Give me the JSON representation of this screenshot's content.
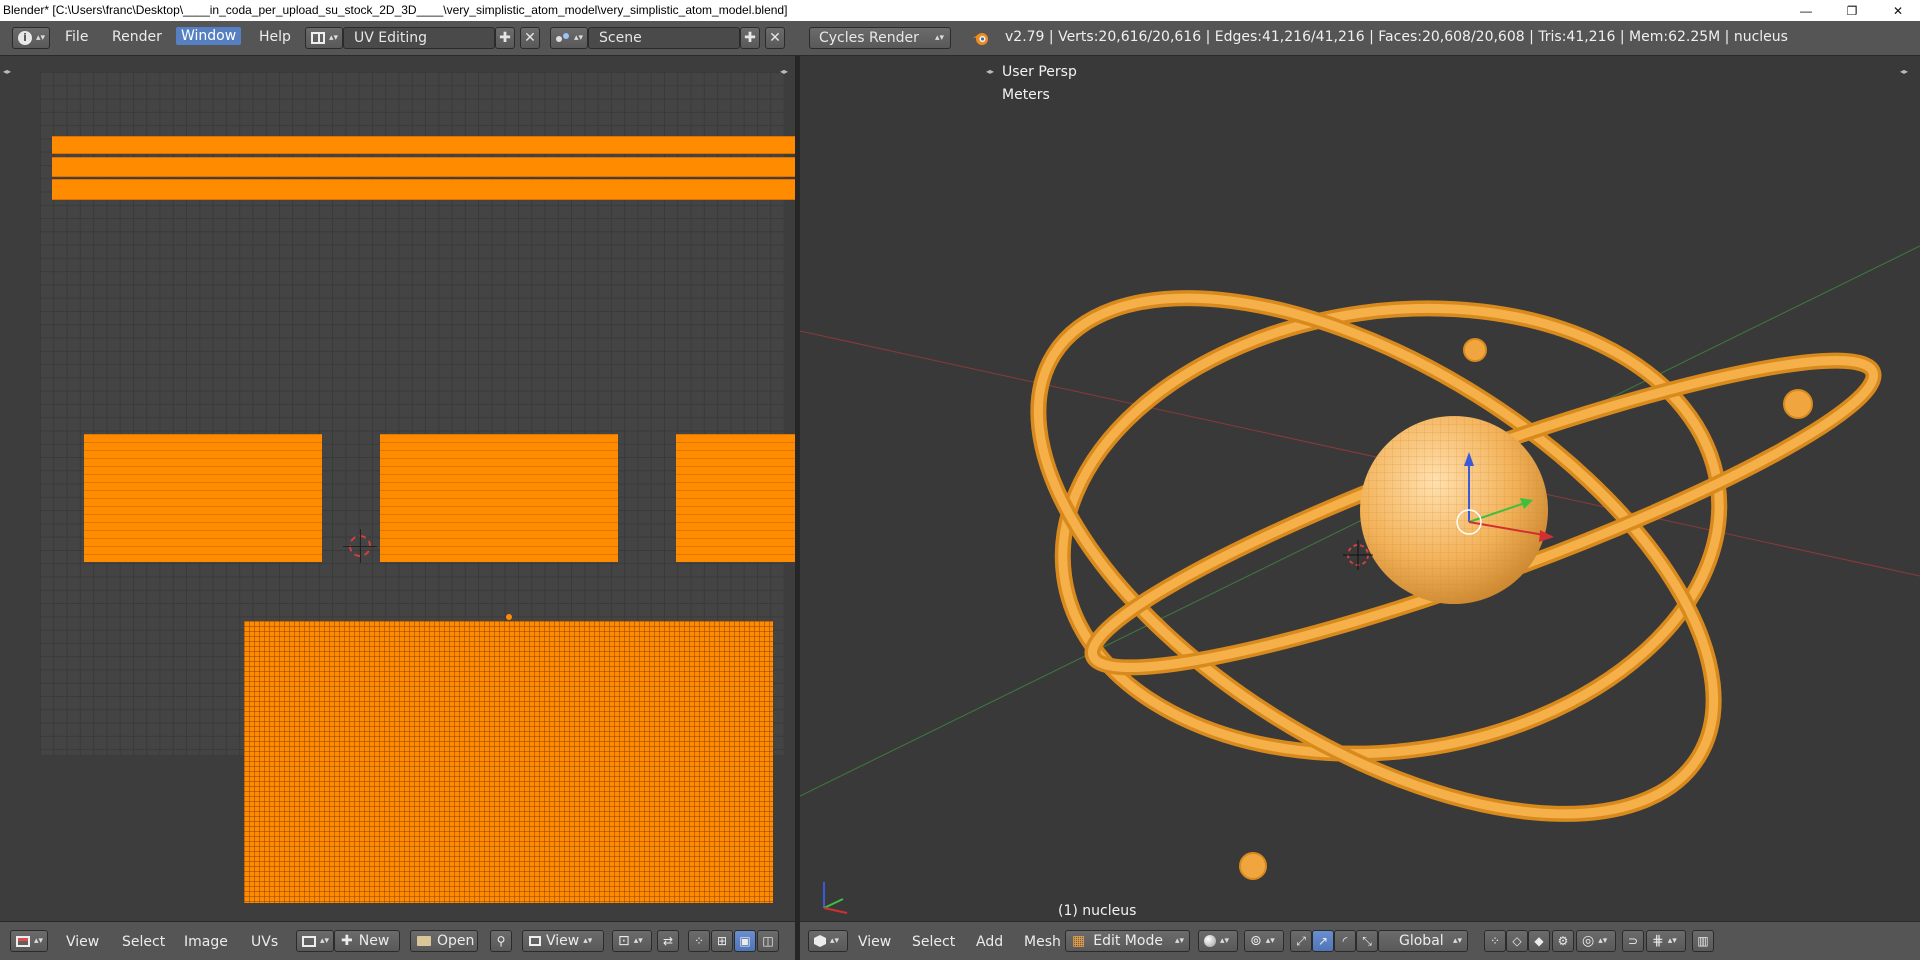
{
  "window": {
    "title": "Blender* [C:\\Users\\franc\\Desktop\\____in_coda_per_upload_su_stock_2D_3D____\\very_simplistic_atom_model\\very_simplistic_atom_model.blend]",
    "minimize_glyph": "—",
    "maximize_glyph": "❐",
    "close_glyph": "✕"
  },
  "info_header": {
    "menus": [
      "File",
      "Render",
      "Window",
      "Help"
    ],
    "active_menu": "Window",
    "layout": "UV Editing",
    "scene": "Scene",
    "render_engine": "Cycles Render",
    "stats": "v2.79 | Verts:20,616/20,616 | Edges:41,216/41,216 | Faces:20,608/20,608 | Tris:41,216 | Mem:62.25M | nucleus",
    "add_glyph": "✚",
    "close_glyph": "✕",
    "logo_icon": "blender-logo-icon"
  },
  "viewport": {
    "view_name": "User Persp",
    "units": "Meters",
    "object_label": "(1) nucleus"
  },
  "uv_footer": {
    "menus": [
      "View",
      "Select",
      "Image",
      "UVs"
    ],
    "new_label": "New",
    "open_label": "Open",
    "view_label": "View"
  },
  "view3d_footer": {
    "menus": [
      "View",
      "Select",
      "Add",
      "Mesh"
    ],
    "mode": "Edit Mode",
    "orientation": "Global"
  },
  "colors": {
    "uv_orange": "#ff8c00",
    "mesh_orange": "#f5a623",
    "active_blue": "#5680c2",
    "header_gray": "#555555"
  }
}
